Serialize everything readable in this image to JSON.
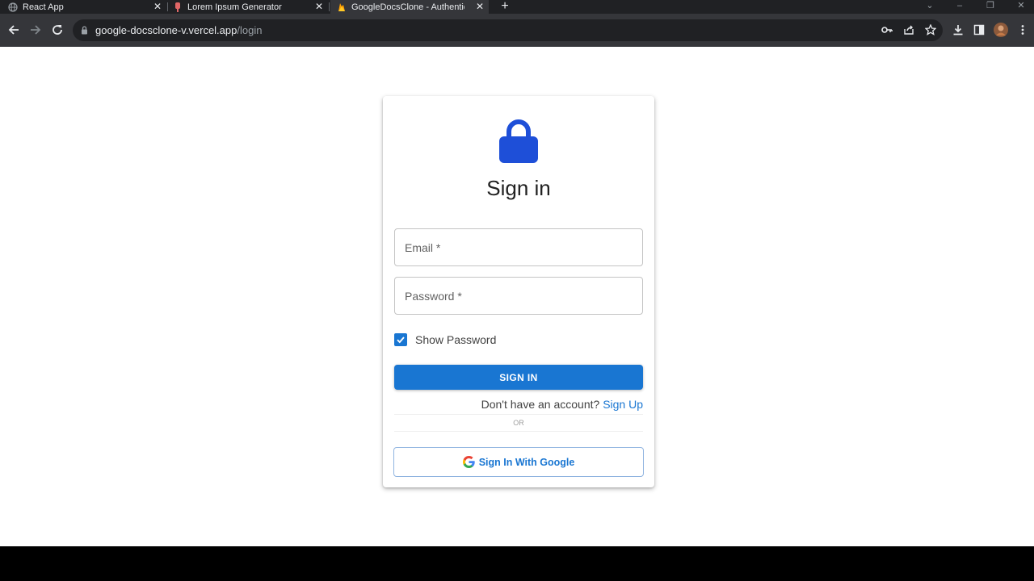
{
  "browser": {
    "tabs": [
      {
        "title": "React App",
        "icon": "globe-icon",
        "active": false
      },
      {
        "title": "Lorem Ipsum Generator",
        "icon": "lorem-ipsum-icon",
        "active": false
      },
      {
        "title": "GoogleDocsClone - Authenticati",
        "icon": "firebase-icon",
        "active": true
      }
    ],
    "new_tab": "+",
    "close_glyph": "✕",
    "url_host": "google-docsclone-v.vercel.app",
    "url_path": "/login"
  },
  "login": {
    "title": "Sign in",
    "email_placeholder": "Email *",
    "password_placeholder": "Password *",
    "show_password_label": "Show Password",
    "show_password_checked": true,
    "sign_in_button": "SIGN IN",
    "no_account_text": "Don't have an account?",
    "sign_up_link": "Sign Up",
    "or_text": "OR",
    "google_button": "Sign In With Google"
  },
  "colors": {
    "primary": "#1976d2",
    "lock": "#1e4fd8",
    "browser_frame": "#202124",
    "toolbar": "#35363a"
  }
}
